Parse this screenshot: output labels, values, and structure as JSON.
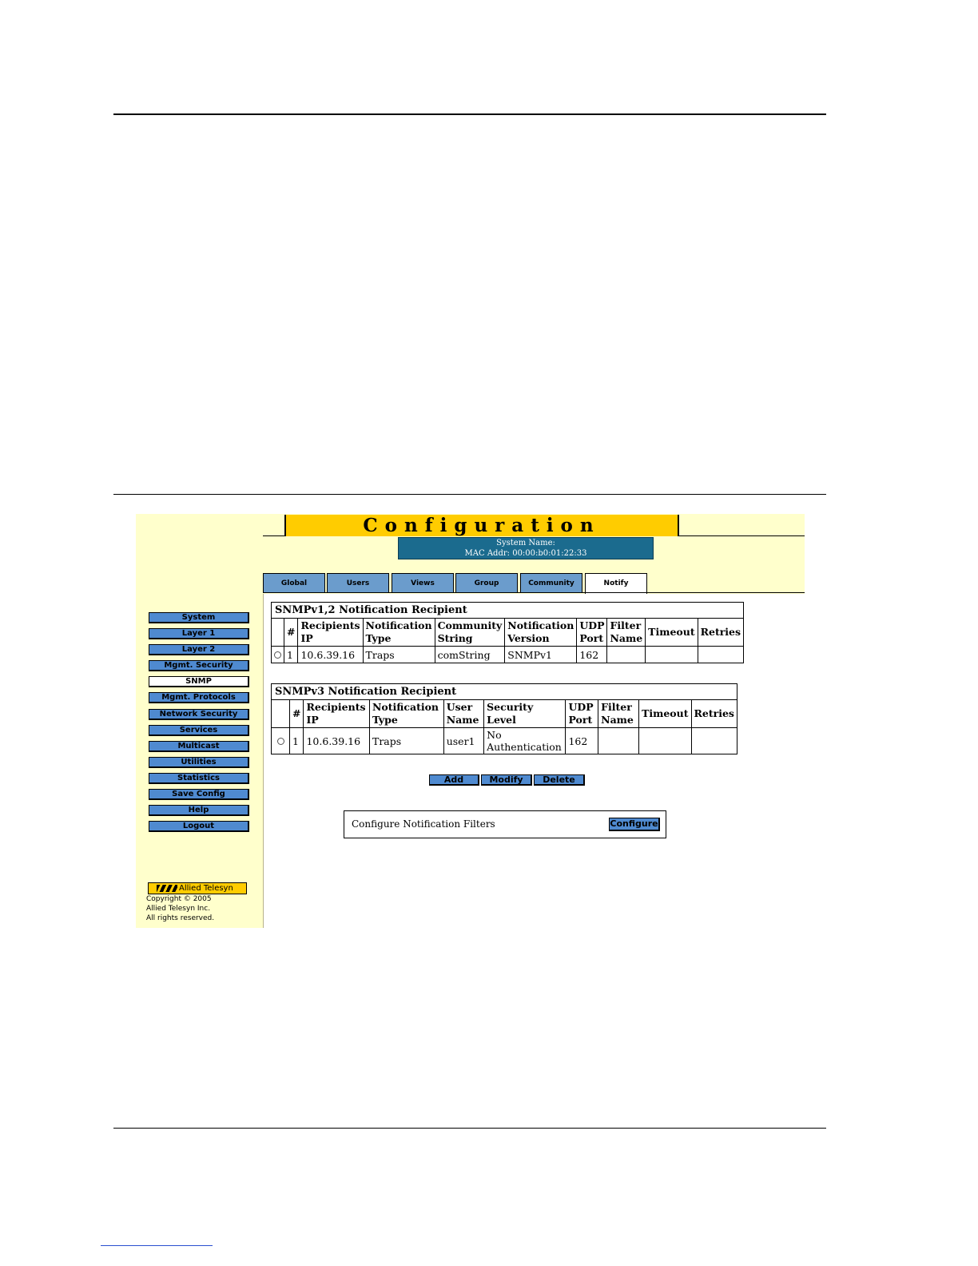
{
  "page": {
    "title": "Configuration",
    "system_name_label": "System Name:",
    "mac_addr_label": "MAC Addr:",
    "mac_addr_value": "00:00:b0:01:22:33"
  },
  "tabs": [
    {
      "label": "Global"
    },
    {
      "label": "Users"
    },
    {
      "label": "Views"
    },
    {
      "label": "Group"
    },
    {
      "label": "Community"
    },
    {
      "label": "Notify",
      "active": true
    }
  ],
  "sidebar": {
    "items": [
      {
        "label": "System"
      },
      {
        "label": "Layer 1"
      },
      {
        "label": "Layer 2"
      },
      {
        "label": "Mgmt. Security"
      },
      {
        "label": "SNMP",
        "active": true
      },
      {
        "label": "Mgmt. Protocols"
      },
      {
        "label": "Network Security"
      },
      {
        "label": "Services"
      },
      {
        "label": "Multicast"
      },
      {
        "label": "Utilities"
      },
      {
        "label": "Statistics"
      },
      {
        "label": "Save Config"
      },
      {
        "label": "Help"
      },
      {
        "label": "Logout"
      }
    ],
    "logo_text": "Allied Telesyn",
    "copyright_lines": [
      "Copyright © 2005",
      "Allied Telesyn Inc.",
      "All rights reserved."
    ]
  },
  "v12_table": {
    "title": "SNMPv1,2 Notification Recipient",
    "headers": [
      "#",
      "Recipients IP",
      "Notification Type",
      "Community String",
      "Notification Version",
      "UDP Port",
      "Filter Name",
      "Timeout",
      "Retries"
    ],
    "rows": [
      {
        "num": "1",
        "ip": "10.6.39.16",
        "type": "Traps",
        "community": "comString",
        "version": "SNMPv1",
        "port": "162",
        "filter": "",
        "timeout": "",
        "retries": ""
      }
    ]
  },
  "v3_table": {
    "title": "SNMPv3 Notification Recipient",
    "headers": [
      "#",
      "Recipients IP",
      "Notification Type",
      "User Name",
      "Security Level",
      "UDP Port",
      "Filter Name",
      "Timeout",
      "Retries"
    ],
    "rows": [
      {
        "num": "1",
        "ip": "10.6.39.16",
        "type": "Traps",
        "user": "user1",
        "security": "No Authentication",
        "port": "162",
        "filter": "",
        "timeout": "",
        "retries": ""
      }
    ]
  },
  "actions": {
    "add": "Add",
    "modify": "Modify",
    "delete": "Delete"
  },
  "filters": {
    "label": "Configure Notification Filters",
    "button": "Configure"
  }
}
